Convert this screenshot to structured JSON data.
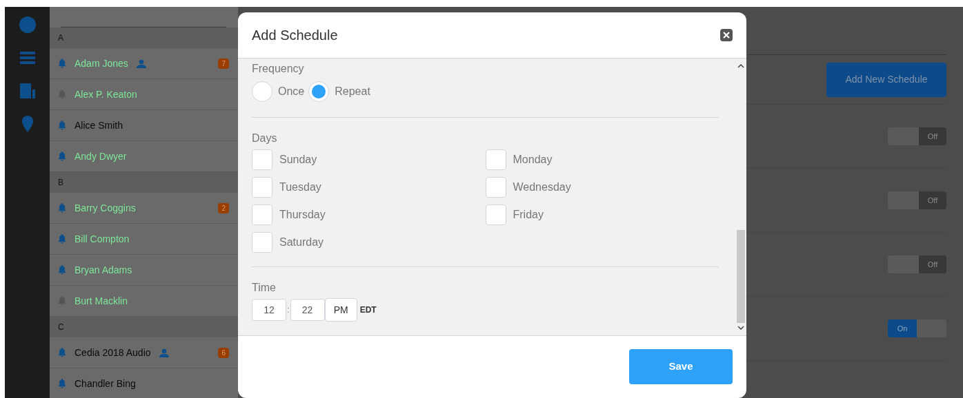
{
  "contacts": [
    {
      "kind": "header",
      "label": "A"
    },
    {
      "kind": "contact",
      "name": "Adam Jones",
      "alerts": true,
      "color": "#7ee69a",
      "shared": true,
      "badge": "7"
    },
    {
      "kind": "contact",
      "name": "Alex P. Keaton",
      "alerts": false,
      "color": "#7ee69a",
      "shared": false
    },
    {
      "kind": "contact",
      "name": "Alice Smith",
      "alerts": true,
      "color": "#0a0a0a",
      "shared": false
    },
    {
      "kind": "contact",
      "name": "Andy Dwyer",
      "alerts": true,
      "color": "#7ee69a",
      "shared": false
    },
    {
      "kind": "header",
      "label": "B"
    },
    {
      "kind": "contact",
      "name": "Barry Coggins",
      "alerts": true,
      "color": "#7ee69a",
      "shared": false,
      "badge": "2"
    },
    {
      "kind": "contact",
      "name": "Bill Compton",
      "alerts": true,
      "color": "#7ee69a",
      "shared": false
    },
    {
      "kind": "contact",
      "name": "Bryan Adams",
      "alerts": true,
      "color": "#7ee69a",
      "shared": false
    },
    {
      "kind": "contact",
      "name": "Burt Macklin",
      "alerts": false,
      "color": "#7ee69a",
      "shared": false
    },
    {
      "kind": "header",
      "label": "C"
    },
    {
      "kind": "contact",
      "name": "Cedia 2018 Audio",
      "alerts": true,
      "color": "#0a0a0a",
      "shared": true,
      "badge": "6"
    },
    {
      "kind": "contact",
      "name": "Chandler Bing",
      "alerts": true,
      "color": "#0a0a0a",
      "shared": false
    }
  ],
  "schedules": {
    "add_button": "Add New Schedule",
    "toggles": [
      {
        "label": "Off",
        "on": false
      },
      {
        "label": "Off",
        "on": false
      },
      {
        "label": "Off",
        "on": false
      },
      {
        "label": "On",
        "on": true
      }
    ]
  },
  "dialog": {
    "title": "Add Schedule",
    "frequency": {
      "label": "Frequency",
      "options": [
        {
          "label": "Once",
          "selected": false
        },
        {
          "label": "Repeat",
          "selected": true
        }
      ]
    },
    "days": {
      "label": "Days",
      "items": [
        {
          "label": "Sunday",
          "checked": false
        },
        {
          "label": "Monday",
          "checked": false
        },
        {
          "label": "Tuesday",
          "checked": false
        },
        {
          "label": "Wednesday",
          "checked": false
        },
        {
          "label": "Thursday",
          "checked": false
        },
        {
          "label": "Friday",
          "checked": false
        },
        {
          "label": "Saturday",
          "checked": false
        }
      ]
    },
    "time": {
      "label": "Time",
      "hour": "12",
      "separator": ":",
      "minute": "22",
      "period": "PM",
      "zone": "EDT"
    },
    "save_button": "Save"
  }
}
